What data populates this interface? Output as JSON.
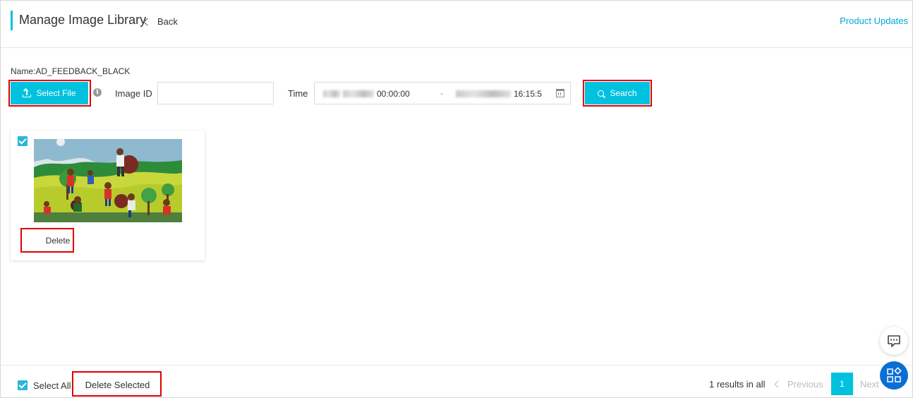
{
  "header": {
    "title": "Manage Image Library",
    "back_label": "Back",
    "product_updates": "Product Updates"
  },
  "filters": {
    "name_label": "Name:AD_FEEDBACK_BLACK",
    "select_file_label": "Select File",
    "info_glyph": "i",
    "image_id_label": "Image ID",
    "image_id_value": "",
    "image_id_placeholder": "",
    "time_label": "Time",
    "time_start": "00:00:00",
    "time_separator": "-",
    "time_end": "16:15:5",
    "search_label": "Search"
  },
  "images": [
    {
      "selected": true,
      "delete_label": "Delete",
      "thumbnail": "children-planting-trees-painting"
    }
  ],
  "footer": {
    "select_all_label": "Select All",
    "delete_selected_label": "Delete Selected",
    "results_text": "1 results in all",
    "previous_label": "Previous",
    "current_page": "1",
    "next_label": "Next"
  },
  "colors": {
    "accent": "#00c1de",
    "link": "#00a8d6",
    "highlight": "#e10000",
    "fab": "#0a6fd4"
  },
  "icons": [
    "chevron-left-icon",
    "upload-icon",
    "info-icon",
    "calendar-icon",
    "search-icon",
    "checkbox-icon",
    "chat-icon",
    "apps-icon"
  ]
}
